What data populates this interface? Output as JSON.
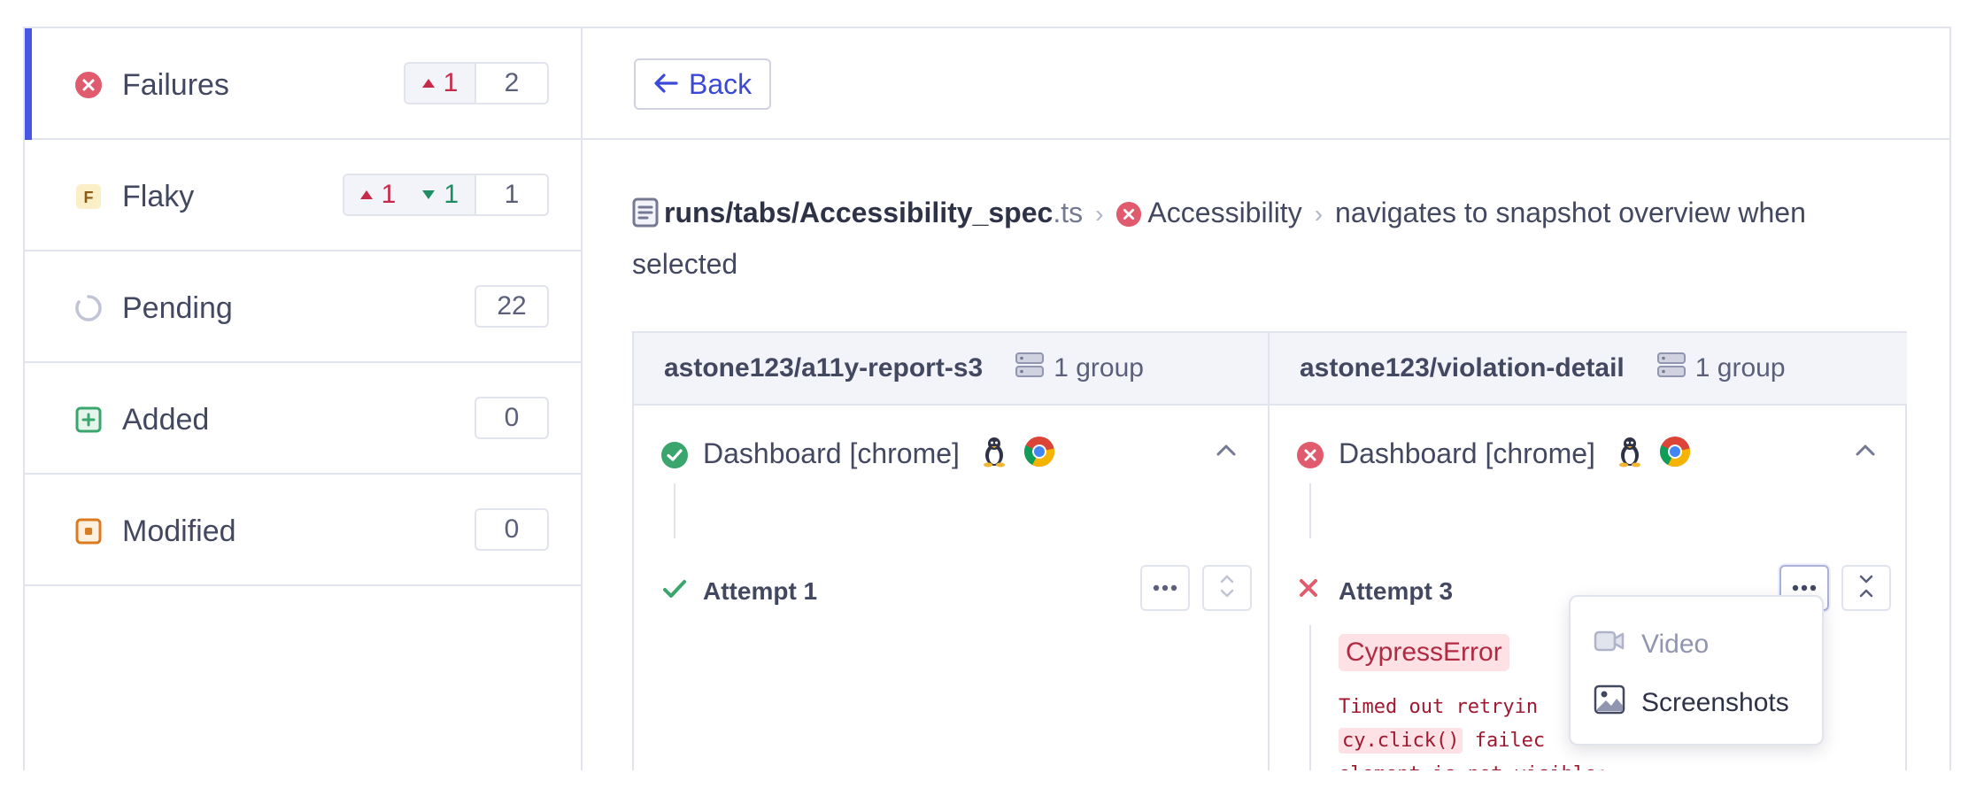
{
  "sidebar": {
    "items": [
      {
        "label": "Failures",
        "icon": "x-circle-icon",
        "active": true,
        "up": "1",
        "total": "2"
      },
      {
        "label": "Flaky",
        "icon": "flaky-icon",
        "flaky_letter": "F",
        "up": "1",
        "down": "1",
        "total": "1"
      },
      {
        "label": "Pending",
        "icon": "pending-spinner-icon",
        "total": "22"
      },
      {
        "label": "Added",
        "icon": "plus-square-icon",
        "total": "0"
      },
      {
        "label": "Modified",
        "icon": "modified-square-icon",
        "total": "0"
      }
    ]
  },
  "header": {
    "back_label": "Back"
  },
  "breadcrumb": {
    "file_name": "runs/tabs/Accessibility_spec",
    "file_ext": ".ts",
    "suite": "Accessibility",
    "test": "navigates to snapshot overview when selected"
  },
  "compare": {
    "left": {
      "branch": "astone123/a11y-report-s3",
      "group": "1 group",
      "run_title": "Dashboard [chrome]",
      "attempt": "Attempt 1",
      "status": "passed"
    },
    "right": {
      "branch": "astone123/violation-detail",
      "group": "1 group",
      "run_title": "Dashboard [chrome]",
      "attempt": "Attempt 3",
      "status": "failed",
      "error_type": "CypressError",
      "error_line1": "Timed out retryin",
      "error_code": "cy.click()",
      "error_line2_rest": " failec",
      "error_line3": "element is not visible:"
    }
  },
  "menu": {
    "video_label": "Video",
    "screenshots_label": "Screenshots"
  },
  "colors": {
    "accent": "#4956e3",
    "failed": "#e05b6e",
    "passed": "#3aa56d"
  }
}
